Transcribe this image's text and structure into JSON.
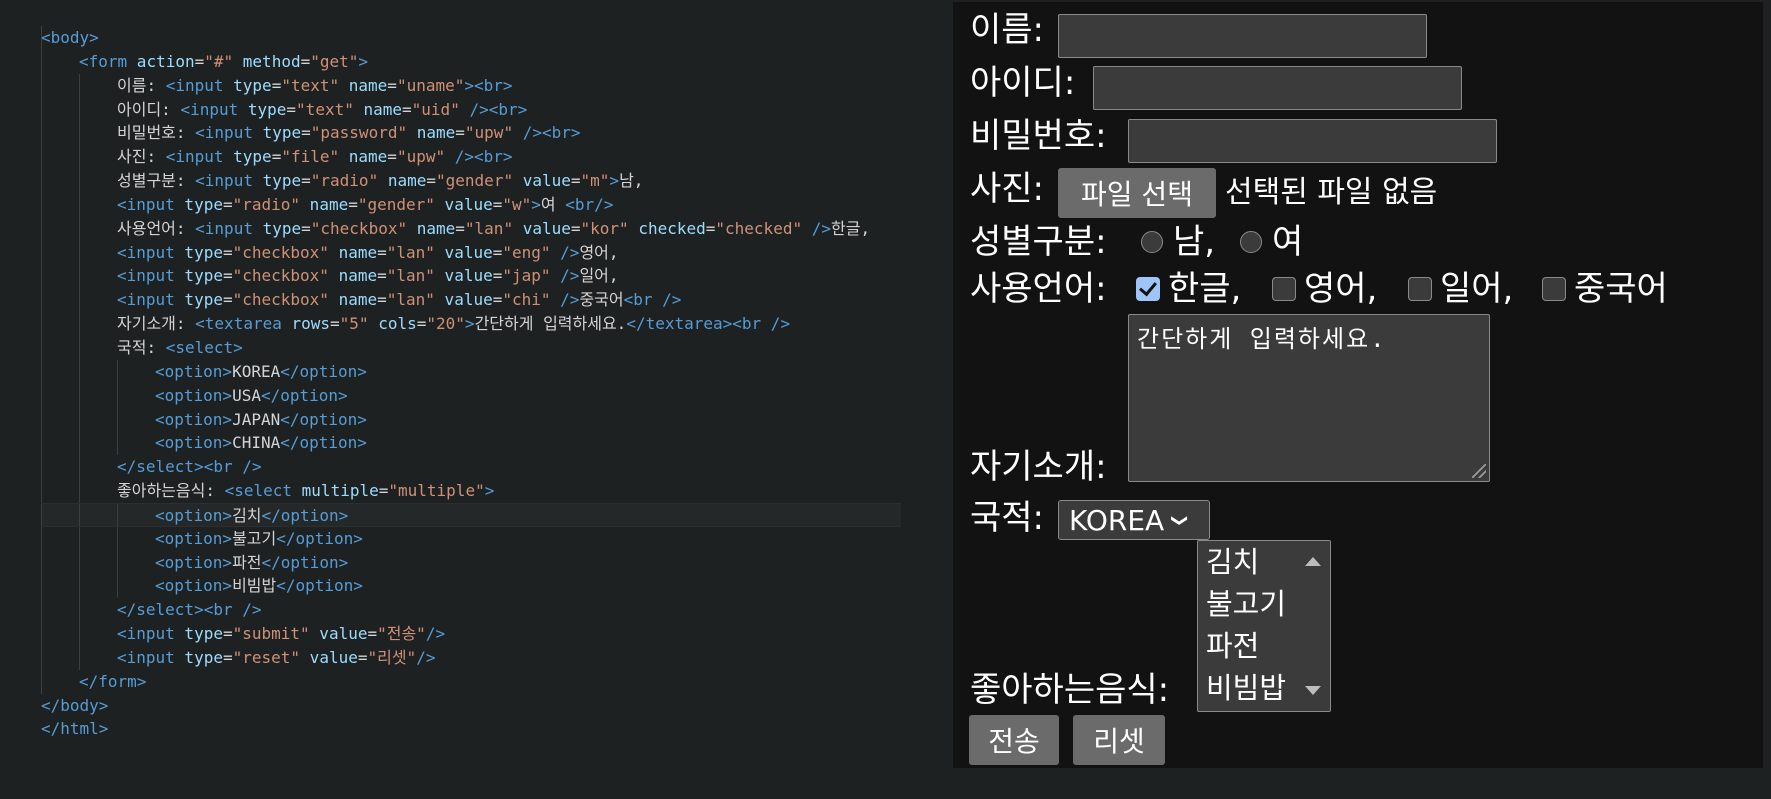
{
  "code_lines": [
    [
      {
        "c": "t",
        "s": "<body>"
      }
    ],
    [
      {
        "c": "t",
        "s": "<form"
      },
      {
        "c": "a",
        "s": " action"
      },
      {
        "c": "x",
        "s": "="
      },
      {
        "c": "v",
        "s": "\"#\""
      },
      {
        "c": "a",
        "s": " method"
      },
      {
        "c": "x",
        "s": "="
      },
      {
        "c": "v",
        "s": "\"get\""
      },
      {
        "c": "t",
        "s": ">"
      }
    ],
    [
      {
        "c": "x",
        "s": "이름: "
      },
      {
        "c": "t",
        "s": "<input"
      },
      {
        "c": "a",
        "s": " type"
      },
      {
        "c": "x",
        "s": "="
      },
      {
        "c": "v",
        "s": "\"text\""
      },
      {
        "c": "a",
        "s": " name"
      },
      {
        "c": "x",
        "s": "="
      },
      {
        "c": "v",
        "s": "\"uname\""
      },
      {
        "c": "t",
        "s": "><br>"
      }
    ],
    [
      {
        "c": "x",
        "s": "아이디: "
      },
      {
        "c": "t",
        "s": "<input"
      },
      {
        "c": "a",
        "s": " type"
      },
      {
        "c": "x",
        "s": "="
      },
      {
        "c": "v",
        "s": "\"text\""
      },
      {
        "c": "a",
        "s": " name"
      },
      {
        "c": "x",
        "s": "="
      },
      {
        "c": "v",
        "s": "\"uid\""
      },
      {
        "c": "t",
        "s": " /><br>"
      }
    ],
    [
      {
        "c": "x",
        "s": "비밀번호: "
      },
      {
        "c": "t",
        "s": "<input"
      },
      {
        "c": "a",
        "s": " type"
      },
      {
        "c": "x",
        "s": "="
      },
      {
        "c": "v",
        "s": "\"password\""
      },
      {
        "c": "a",
        "s": " name"
      },
      {
        "c": "x",
        "s": "="
      },
      {
        "c": "v",
        "s": "\"upw\""
      },
      {
        "c": "t",
        "s": " /><br>"
      }
    ],
    [
      {
        "c": "x",
        "s": "사진: "
      },
      {
        "c": "t",
        "s": "<input"
      },
      {
        "c": "a",
        "s": " type"
      },
      {
        "c": "x",
        "s": "="
      },
      {
        "c": "v",
        "s": "\"file\""
      },
      {
        "c": "a",
        "s": " name"
      },
      {
        "c": "x",
        "s": "="
      },
      {
        "c": "v",
        "s": "\"upw\""
      },
      {
        "c": "t",
        "s": " /><br>"
      }
    ],
    [
      {
        "c": "x",
        "s": "성별구분: "
      },
      {
        "c": "t",
        "s": "<input"
      },
      {
        "c": "a",
        "s": " type"
      },
      {
        "c": "x",
        "s": "="
      },
      {
        "c": "v",
        "s": "\"radio\""
      },
      {
        "c": "a",
        "s": " name"
      },
      {
        "c": "x",
        "s": "="
      },
      {
        "c": "v",
        "s": "\"gender\""
      },
      {
        "c": "a",
        "s": " value"
      },
      {
        "c": "x",
        "s": "="
      },
      {
        "c": "v",
        "s": "\"m\""
      },
      {
        "c": "t",
        "s": ">"
      },
      {
        "c": "x",
        "s": "남,"
      }
    ],
    [
      {
        "c": "t",
        "s": "<input"
      },
      {
        "c": "a",
        "s": " type"
      },
      {
        "c": "x",
        "s": "="
      },
      {
        "c": "v",
        "s": "\"radio\""
      },
      {
        "c": "a",
        "s": " name"
      },
      {
        "c": "x",
        "s": "="
      },
      {
        "c": "v",
        "s": "\"gender\""
      },
      {
        "c": "a",
        "s": " value"
      },
      {
        "c": "x",
        "s": "="
      },
      {
        "c": "v",
        "s": "\"w\""
      },
      {
        "c": "t",
        "s": ">"
      },
      {
        "c": "x",
        "s": "여 "
      },
      {
        "c": "t",
        "s": "<br/>"
      }
    ],
    [
      {
        "c": "x",
        "s": "사용언어: "
      },
      {
        "c": "t",
        "s": "<input"
      },
      {
        "c": "a",
        "s": " type"
      },
      {
        "c": "x",
        "s": "="
      },
      {
        "c": "v",
        "s": "\"checkbox\""
      },
      {
        "c": "a",
        "s": " name"
      },
      {
        "c": "x",
        "s": "="
      },
      {
        "c": "v",
        "s": "\"lan\""
      },
      {
        "c": "a",
        "s": " value"
      },
      {
        "c": "x",
        "s": "="
      },
      {
        "c": "v",
        "s": "\"kor\""
      },
      {
        "c": "a",
        "s": " checked"
      },
      {
        "c": "x",
        "s": "="
      },
      {
        "c": "v",
        "s": "\"checked\""
      },
      {
        "c": "t",
        "s": " />"
      },
      {
        "c": "x",
        "s": "한글,"
      }
    ],
    [
      {
        "c": "t",
        "s": "<input"
      },
      {
        "c": "a",
        "s": " type"
      },
      {
        "c": "x",
        "s": "="
      },
      {
        "c": "v",
        "s": "\"checkbox\""
      },
      {
        "c": "a",
        "s": " name"
      },
      {
        "c": "x",
        "s": "="
      },
      {
        "c": "v",
        "s": "\"lan\""
      },
      {
        "c": "a",
        "s": " value"
      },
      {
        "c": "x",
        "s": "="
      },
      {
        "c": "v",
        "s": "\"eng\""
      },
      {
        "c": "t",
        "s": " />"
      },
      {
        "c": "x",
        "s": "영어,"
      }
    ],
    [
      {
        "c": "t",
        "s": "<input"
      },
      {
        "c": "a",
        "s": " type"
      },
      {
        "c": "x",
        "s": "="
      },
      {
        "c": "v",
        "s": "\"checkbox\""
      },
      {
        "c": "a",
        "s": " name"
      },
      {
        "c": "x",
        "s": "="
      },
      {
        "c": "v",
        "s": "\"lan\""
      },
      {
        "c": "a",
        "s": " value"
      },
      {
        "c": "x",
        "s": "="
      },
      {
        "c": "v",
        "s": "\"jap\""
      },
      {
        "c": "t",
        "s": " />"
      },
      {
        "c": "x",
        "s": "일어,"
      }
    ],
    [
      {
        "c": "t",
        "s": "<input"
      },
      {
        "c": "a",
        "s": " type"
      },
      {
        "c": "x",
        "s": "="
      },
      {
        "c": "v",
        "s": "\"checkbox\""
      },
      {
        "c": "a",
        "s": " name"
      },
      {
        "c": "x",
        "s": "="
      },
      {
        "c": "v",
        "s": "\"lan\""
      },
      {
        "c": "a",
        "s": " value"
      },
      {
        "c": "x",
        "s": "="
      },
      {
        "c": "v",
        "s": "\"chi\""
      },
      {
        "c": "t",
        "s": " />"
      },
      {
        "c": "x",
        "s": "중국어"
      },
      {
        "c": "t",
        "s": "<br />"
      }
    ],
    [
      {
        "c": "x",
        "s": "자기소개: "
      },
      {
        "c": "t",
        "s": "<textarea"
      },
      {
        "c": "a",
        "s": " rows"
      },
      {
        "c": "x",
        "s": "="
      },
      {
        "c": "v",
        "s": "\"5\""
      },
      {
        "c": "a",
        "s": " cols"
      },
      {
        "c": "x",
        "s": "="
      },
      {
        "c": "v",
        "s": "\"20\""
      },
      {
        "c": "t",
        "s": ">"
      },
      {
        "c": "x",
        "s": "간단하게 입력하세요."
      },
      {
        "c": "t",
        "s": "</textarea><br />"
      }
    ],
    [
      {
        "c": "x",
        "s": "국적: "
      },
      {
        "c": "t",
        "s": "<select>"
      }
    ],
    [
      {
        "c": "t",
        "s": "<option>"
      },
      {
        "c": "x",
        "s": "KOREA"
      },
      {
        "c": "t",
        "s": "</option>"
      }
    ],
    [
      {
        "c": "t",
        "s": "<option>"
      },
      {
        "c": "x",
        "s": "USA"
      },
      {
        "c": "t",
        "s": "</option>"
      }
    ],
    [
      {
        "c": "t",
        "s": "<option>"
      },
      {
        "c": "x",
        "s": "JAPAN"
      },
      {
        "c": "t",
        "s": "</option>"
      }
    ],
    [
      {
        "c": "t",
        "s": "<option>"
      },
      {
        "c": "x",
        "s": "CHINA"
      },
      {
        "c": "t",
        "s": "</option>"
      }
    ],
    [
      {
        "c": "t",
        "s": "</select><br />"
      }
    ],
    [
      {
        "c": "x",
        "s": "좋아하는음식: "
      },
      {
        "c": "t",
        "s": "<select"
      },
      {
        "c": "a",
        "s": " multiple"
      },
      {
        "c": "x",
        "s": "="
      },
      {
        "c": "v",
        "s": "\"multiple\""
      },
      {
        "c": "t",
        "s": ">"
      }
    ],
    [
      {
        "c": "t",
        "s": "<option>"
      },
      {
        "c": "x",
        "s": "김치"
      },
      {
        "c": "t",
        "s": "</option>"
      }
    ],
    [
      {
        "c": "t",
        "s": "<option>"
      },
      {
        "c": "x",
        "s": "불고기"
      },
      {
        "c": "t",
        "s": "</option>"
      }
    ],
    [
      {
        "c": "t",
        "s": "<option>"
      },
      {
        "c": "x",
        "s": "파전"
      },
      {
        "c": "t",
        "s": "</option>"
      }
    ],
    [
      {
        "c": "t",
        "s": "<option>"
      },
      {
        "c": "x",
        "s": "비빔밥"
      },
      {
        "c": "t",
        "s": "</option>"
      }
    ],
    [
      {
        "c": "t",
        "s": "</select><br />"
      }
    ],
    [
      {
        "c": "t",
        "s": "<input"
      },
      {
        "c": "a",
        "s": " type"
      },
      {
        "c": "x",
        "s": "="
      },
      {
        "c": "v",
        "s": "\"submit\""
      },
      {
        "c": "a",
        "s": " value"
      },
      {
        "c": "x",
        "s": "="
      },
      {
        "c": "v",
        "s": "\"전송\""
      },
      {
        "c": "t",
        "s": "/>"
      }
    ],
    [
      {
        "c": "t",
        "s": "<input"
      },
      {
        "c": "a",
        "s": " type"
      },
      {
        "c": "x",
        "s": "="
      },
      {
        "c": "v",
        "s": "\"reset\""
      },
      {
        "c": "a",
        "s": " value"
      },
      {
        "c": "x",
        "s": "="
      },
      {
        "c": "v",
        "s": "\"리셋\""
      },
      {
        "c": "t",
        "s": "/>"
      }
    ],
    [
      {
        "c": "t",
        "s": "</form>"
      }
    ],
    [
      {
        "c": "t",
        "s": "</body>"
      }
    ],
    [
      {
        "c": "t",
        "s": "</html>"
      }
    ]
  ],
  "form": {
    "name_label": "이름:",
    "id_label": "아이디:",
    "password_label": "비밀번호:",
    "photo_label": "사진:",
    "file_button": "파일 선택",
    "file_status": "선택된 파일 없음",
    "gender_label": "성별구분:",
    "gender_male": "남,",
    "gender_female": "여",
    "language_label": "사용언어:",
    "lang_kor": "한글,",
    "lang_eng": "영어,",
    "lang_jap": "일어,",
    "lang_chi": "중국어",
    "intro_label": "자기소개:",
    "intro_value": "간단하게 입력하세요.",
    "nationality_label": "국적:",
    "nationality_selected": "KOREA",
    "food_label": "좋아하는음식:",
    "food_options": [
      "김치",
      "불고기",
      "파전",
      "비빔밥"
    ],
    "submit_label": "전송",
    "reset_label": "리셋"
  },
  "colors": {
    "editor_bg": "#1e2121",
    "preview_bg": "#121212",
    "tag": "#569cd6",
    "attr": "#9cdcfe",
    "value": "#ce9178",
    "checkbox_checked": "#9ec5f7"
  }
}
